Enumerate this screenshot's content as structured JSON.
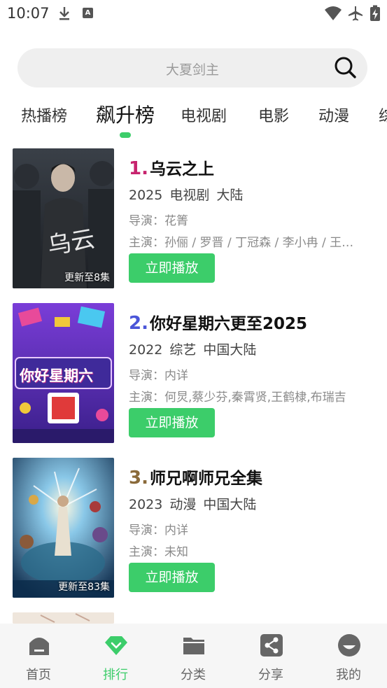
{
  "status_bar": {
    "time": "10:07",
    "badge": "A"
  },
  "search": {
    "placeholder": "大夏剑主"
  },
  "tabs": [
    {
      "label": "热播榜"
    },
    {
      "label": "飙升榜",
      "active": true
    },
    {
      "label": "电视剧"
    },
    {
      "label": "电影"
    },
    {
      "label": "动漫"
    },
    {
      "label": "综"
    }
  ],
  "items": [
    {
      "rank": "1.",
      "rank_color": "#c7246e",
      "title": "乌云之上",
      "year": "2025",
      "genre": "电视剧",
      "region": "大陆",
      "director": "导演：花箐",
      "cast": "主演：孙俪 / 罗晋 / 丁冠森 / 李小冉 / 王…",
      "update": "更新至8集",
      "play_label": "立即播放"
    },
    {
      "rank": "2.",
      "rank_color": "#4a55d8",
      "title": "你好星期六更至2025",
      "year": "2022",
      "genre": "综艺",
      "region": "中国大陆",
      "director": "导演：内详",
      "cast": "主演：何炅,蔡少芬,秦霄贤,王鹤棣,布瑞吉",
      "update": "",
      "poster_text": "你好星期六",
      "play_label": "立即播放"
    },
    {
      "rank": "3.",
      "rank_color": "#8a6a3a",
      "title": "师兄啊师兄全集",
      "year": "2023",
      "genre": "动漫",
      "region": "中国大陆",
      "director": "导演：内详",
      "cast": "主演：未知",
      "update": "更新至83集",
      "play_label": "立即播放"
    }
  ],
  "bottom_nav": [
    {
      "label": "首页",
      "icon": "home-icon"
    },
    {
      "label": "排行",
      "icon": "ranking-icon",
      "active": true
    },
    {
      "label": "分类",
      "icon": "folder-icon"
    },
    {
      "label": "分享",
      "icon": "share-icon"
    },
    {
      "label": "我的",
      "icon": "profile-icon"
    }
  ],
  "colors": {
    "accent": "#3ccd6a",
    "search_bg": "#efefef",
    "nav_bg": "#f6f6f6"
  }
}
